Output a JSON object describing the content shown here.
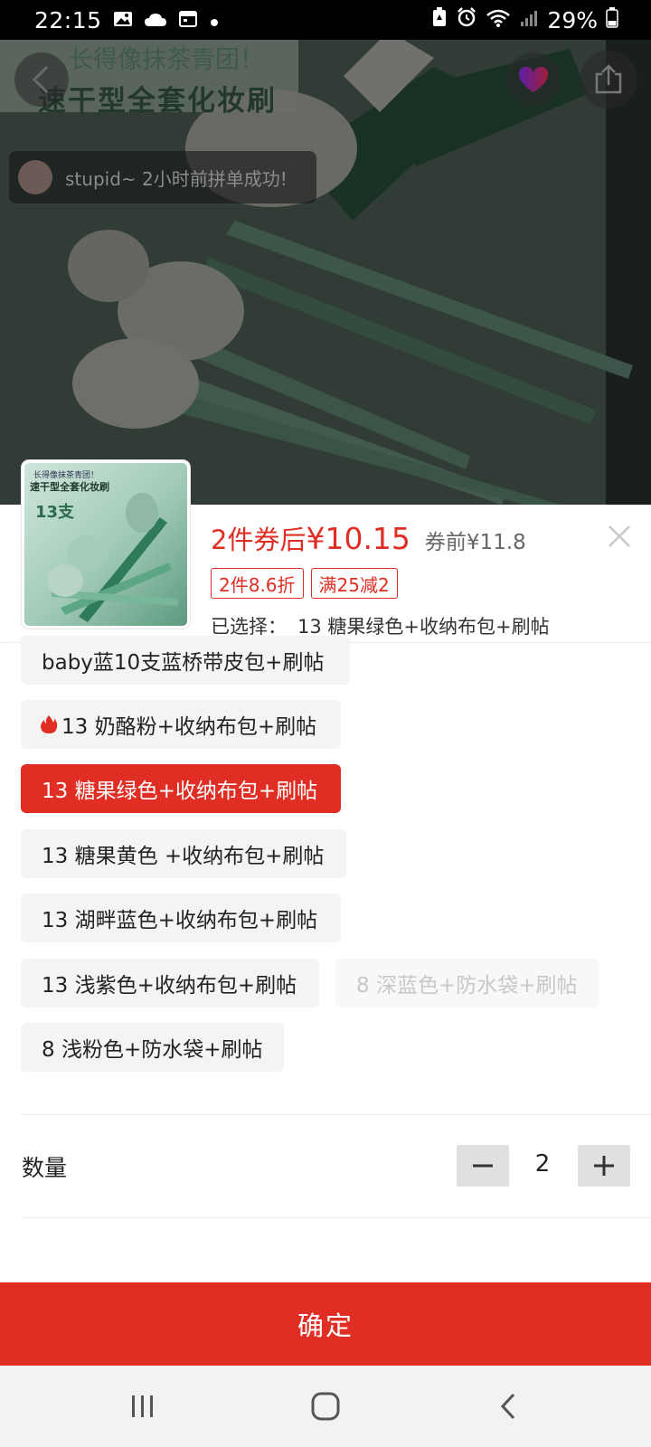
{
  "status_bar": {
    "time": "22:15",
    "battery_percent": "29%",
    "left_icons": [
      "image-icon",
      "cloud-icon",
      "calendar-icon",
      "dot-icon"
    ],
    "right_icons": [
      "battery-saver-icon",
      "alarm-icon",
      "wifi-icon",
      "signal-icon",
      "battery-icon"
    ]
  },
  "hero": {
    "caption_line1": "长得像抹茶青团！",
    "caption_line2": "速干型全套化妆刷",
    "toast_text": "stupid~ 2小时前拼单成功!"
  },
  "thumbnail": {
    "line1": "长得像抹茶青团！",
    "line2": "速干型全套化妆刷",
    "line3": "13支"
  },
  "price": {
    "prefix": "2件券后",
    "amount": "¥10.15",
    "original": "券前¥11.8"
  },
  "tags": [
    "2件8.6折",
    "满25减2"
  ],
  "selected": {
    "label": "已选择：",
    "value": "13 糖果绿色+收纳布包+刷帖"
  },
  "options": [
    {
      "label": "baby蓝10支蓝桥带皮包+刷帖",
      "state": "normal",
      "hot": false
    },
    {
      "label": "13 奶酪粉+收纳布包+刷帖",
      "state": "normal",
      "hot": true
    },
    {
      "label": "13 糖果绿色+收纳布包+刷帖",
      "state": "selected",
      "hot": false
    },
    {
      "label": "13 糖果黄色 +收纳布包+刷帖",
      "state": "normal",
      "hot": false
    },
    {
      "label": "13 湖畔蓝色+收纳布包+刷帖",
      "state": "normal",
      "hot": false
    },
    {
      "label": "13 浅紫色+收纳布包+刷帖",
      "state": "normal",
      "hot": false
    },
    {
      "label": "8 深蓝色+防水袋+刷帖",
      "state": "disabled",
      "hot": false
    },
    {
      "label": "8 浅粉色+防水袋+刷帖",
      "state": "normal",
      "hot": false
    }
  ],
  "quantity": {
    "label": "数量",
    "value": "2"
  },
  "confirm_label": "确定",
  "colors": {
    "accent": "#e02e24",
    "option_bg": "#f4f4f4",
    "disabled_text": "#c8c8c8"
  }
}
